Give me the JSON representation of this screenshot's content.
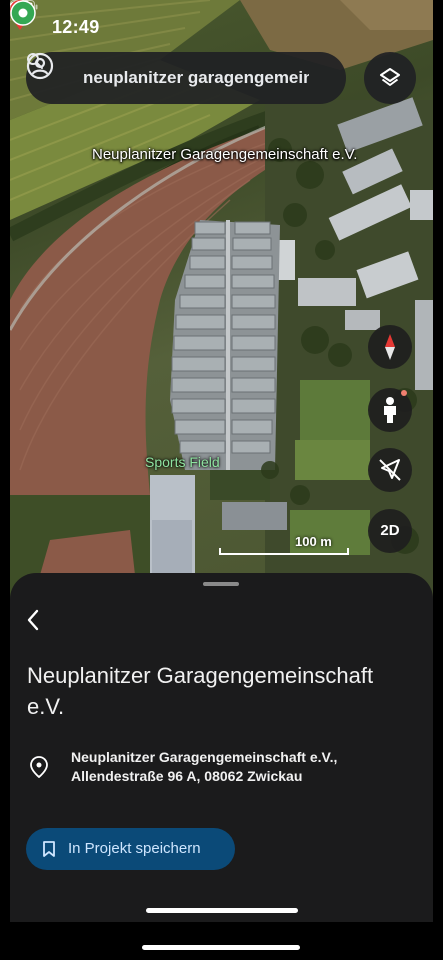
{
  "status_bar": {
    "time": "12:49"
  },
  "search": {
    "query": "neuplanitzer garagengemeinschaft"
  },
  "map": {
    "place_label": "Neuplanitzer Garagengemeinschaft e.V.",
    "poi_label": "Sports Field",
    "scale_label": "100 m",
    "view_mode_button": "2D"
  },
  "place": {
    "name": "Neuplanitzer Garagengemeinschaft e.V.",
    "address": "Neuplanitzer Garagengemeinschaft e.V., Allendestraße 96 A, 08062 Zwickau",
    "save_button": "In Projekt speichern"
  },
  "colors": {
    "pin": "#e53935",
    "poi": "#34a853",
    "save_button_bg": "#0b4a78",
    "sheet_bg": "#1b1b1c"
  }
}
